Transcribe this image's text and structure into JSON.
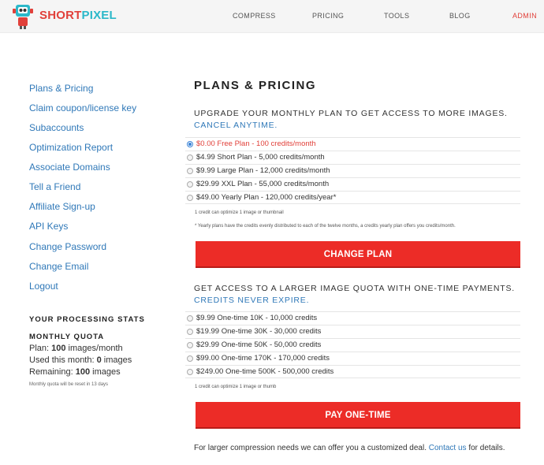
{
  "brand": {
    "part1": "SHORT",
    "part2": "PIXEL"
  },
  "nav": [
    "COMPRESS",
    "PRICING",
    "TOOLS",
    "BLOG",
    "ADMIN"
  ],
  "sidebar": {
    "links": [
      "Plans & Pricing",
      "Claim coupon/license key",
      "Subaccounts",
      "Optimization Report",
      "Associate Domains",
      "Tell a Friend",
      "Affiliate Sign-up",
      "API Keys",
      "Change Password",
      "Change Email",
      "Logout"
    ],
    "stats_title": "YOUR PROCESSING STATS",
    "quota_title": "MONTHLY QUOTA",
    "plan_label": "Plan: ",
    "plan_value": "100",
    "plan_suffix": " images/month",
    "used_label": "Used this month: ",
    "used_value": "0",
    "used_suffix": " images",
    "remaining_label": "Remaining: ",
    "remaining_value": "100",
    "remaining_suffix": " images",
    "reset_note": "Monthly quota will be reset in 13 days"
  },
  "main": {
    "title": "PLANS & PRICING",
    "monthly": {
      "heading": "UPGRADE YOUR MONTHLY PLAN TO GET ACCESS TO MORE IMAGES.",
      "sub": "CANCEL ANYTIME.",
      "plans": [
        "$0.00 Free Plan - 100 credits/month",
        "$4.99 Short Plan - 5,000 credits/month",
        "$9.99 Large Plan - 12,000 credits/month",
        "$29.99 XXL Plan - 55,000 credits/month",
        "$49.00 Yearly Plan - 120,000 credits/year*"
      ],
      "note1": "1 credit can optimize 1 image or thumbnail",
      "note2": "* Yearly plans have the credits evenly distributed to each of the twelve months, a credits yearly plan offers you credits/month.",
      "button": "CHANGE PLAN"
    },
    "onetime": {
      "heading": "GET ACCESS TO A LARGER IMAGE QUOTA WITH ONE-TIME PAYMENTS.",
      "sub": "CREDITS NEVER EXPIRE.",
      "plans": [
        "$9.99 One-time 10K - 10,000 credits",
        "$19.99 One-time 30K - 30,000 credits",
        "$29.99 One-time 50K - 50,000 credits",
        "$99.00 One-time 170K - 170,000 credits",
        "$249.00 One-time 500K - 500,000 credits"
      ],
      "note": "1 credit can optimize 1 image or thumb",
      "button": "PAY ONE-TIME"
    },
    "footer": {
      "before": "For larger compression needs we can offer you a customized deal. ",
      "link": "Contact us",
      "after": " for details."
    }
  }
}
